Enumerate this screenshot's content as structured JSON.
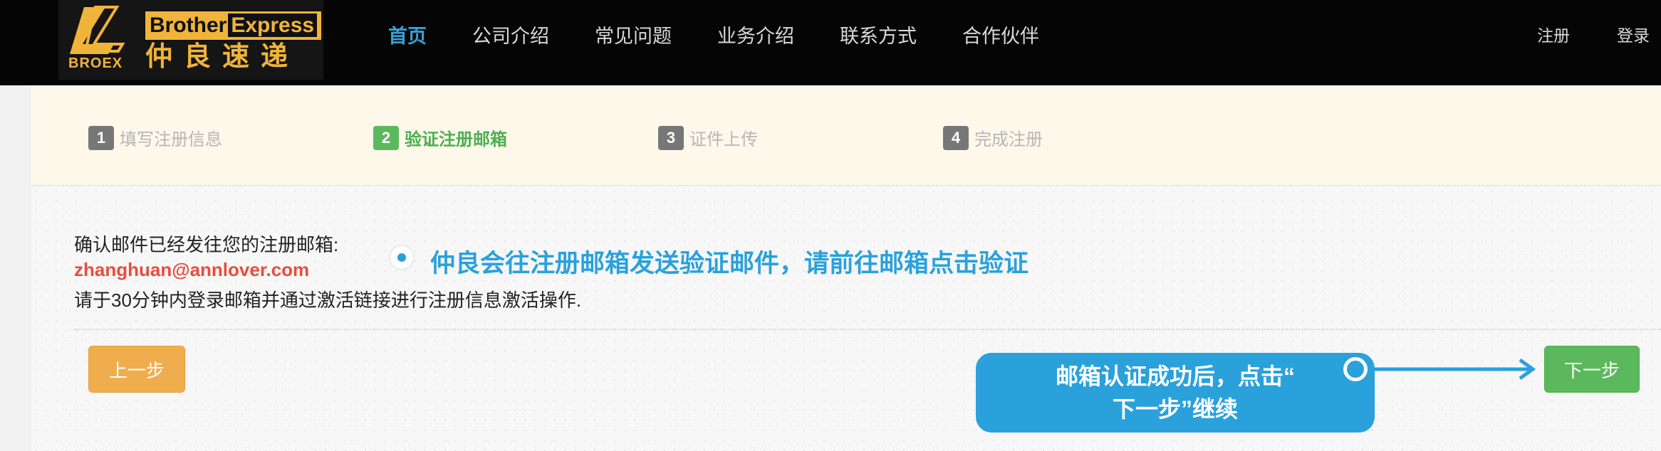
{
  "brand": {
    "en_name_1": "Brother",
    "en_name_2": "Express",
    "cn_name": "仲良速递",
    "sub": "BROEX"
  },
  "nav": {
    "items": [
      "首页",
      "公司介绍",
      "常见问题",
      "业务介绍",
      "联系方式",
      "合作伙伴"
    ],
    "active_index": 0,
    "register": "注册",
    "login": "登录"
  },
  "steps": [
    {
      "num": "1",
      "label": "填写注册信息"
    },
    {
      "num": "2",
      "label": "验证注册邮箱"
    },
    {
      "num": "3",
      "label": "证件上传"
    },
    {
      "num": "4",
      "label": "完成注册"
    }
  ],
  "current_step": 2,
  "main": {
    "confirm_text": "确认邮件已经发往您的注册邮箱:",
    "email": "zhanghuan@annlover.com",
    "instruction": "请于30分钟内登录邮箱并通过激活链接进行注册信息激活操作.",
    "hint": "仲良会往注册邮箱发送验证邮件，请前往邮箱点击验证",
    "prev_button": "上一步",
    "next_button": "下一步",
    "callout_line1": "邮箱认证成功后，点击“",
    "callout_line2": "下一步”继续"
  },
  "colors": {
    "accent": "#2aa1db",
    "email": "#e84d3d",
    "step_current": "#5cb85c",
    "prev_btn": "#f0ad4e",
    "next_btn": "#5cb85c",
    "brand": "#f0b43a"
  }
}
